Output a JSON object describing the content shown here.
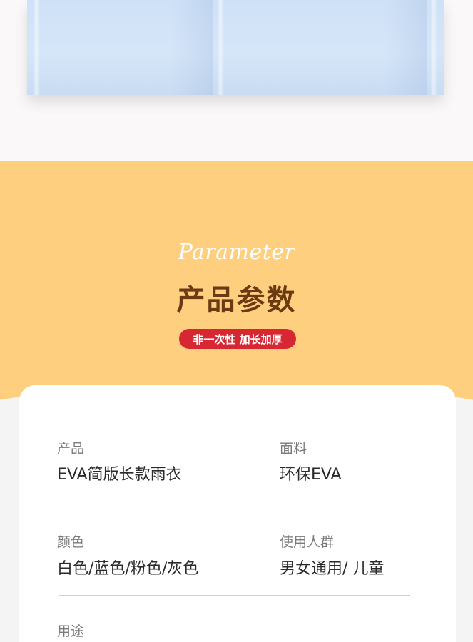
{
  "header": {
    "script_title": "Parameter",
    "title": "产品参数",
    "badge": "非一次性 加长加厚"
  },
  "params": {
    "product_label": "产品",
    "product_value": "EVA简版长款雨衣",
    "fabric_label": "面料",
    "fabric_value": "环保EVA",
    "color_label": "颜色",
    "color_value": "白色/蓝色/粉色/灰色",
    "users_label": "使用人群",
    "users_value": "男女通用/ 儿童",
    "usage_label": "用途"
  },
  "colors": {
    "accent_yellow": "#fdcf7f",
    "title_brown": "#6b3a13",
    "badge_red": "#d62733"
  }
}
